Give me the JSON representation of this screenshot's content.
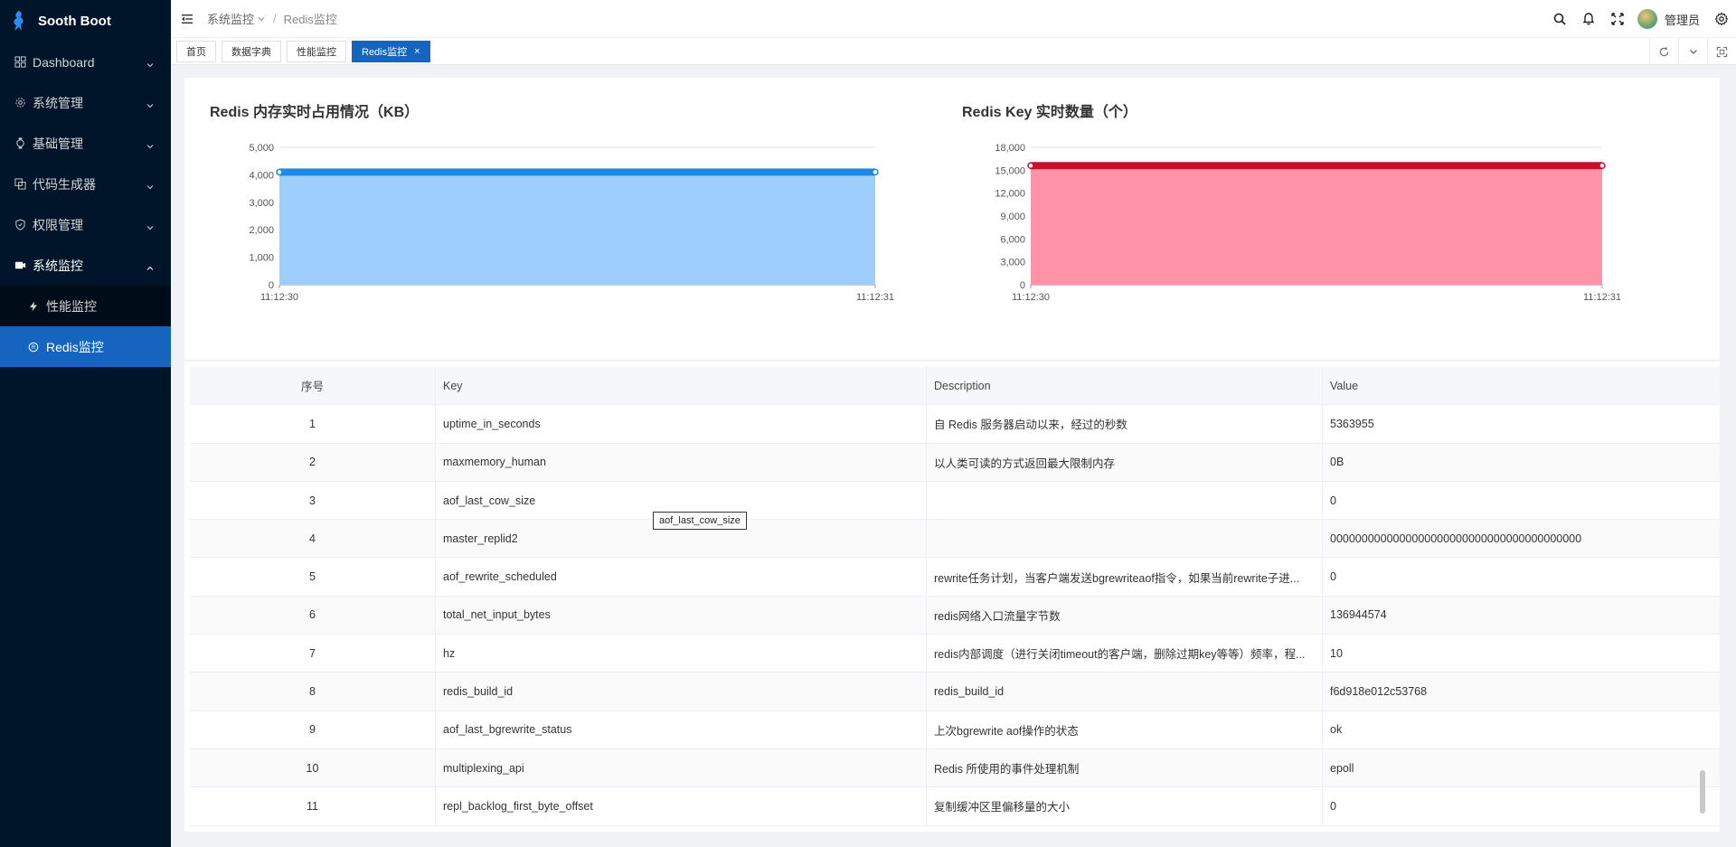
{
  "app": {
    "name": "Sooth Boot"
  },
  "sidebar": {
    "items": [
      {
        "label": "Dashboard",
        "icon": "dashboard-icon",
        "open": false
      },
      {
        "label": "系统管理",
        "icon": "gear-icon",
        "open": false
      },
      {
        "label": "基础管理",
        "icon": "watch-icon",
        "open": false
      },
      {
        "label": "代码生成器",
        "icon": "code-icon",
        "open": false
      },
      {
        "label": "权限管理",
        "icon": "shield-icon",
        "open": false
      },
      {
        "label": "系统监控",
        "icon": "monitor-icon",
        "open": true
      }
    ],
    "sub_items": [
      {
        "label": "性能监控",
        "icon": "lightning-icon",
        "active": false
      },
      {
        "label": "Redis监控",
        "icon": "redis-icon",
        "active": true
      }
    ],
    "accent": "#1565c0",
    "bg": "#001529"
  },
  "header": {
    "breadcrumb": [
      "系统监控",
      "Redis监控"
    ],
    "user": "管理员"
  },
  "tabs": [
    {
      "label": "首页",
      "active": false
    },
    {
      "label": "数据字典",
      "active": false
    },
    {
      "label": "性能监控",
      "active": false
    },
    {
      "label": "Redis监控",
      "active": true,
      "closable": true
    }
  ],
  "chart_data": [
    {
      "type": "area",
      "title": "Redis 内存实时占用情况（KB）",
      "x": [
        "11:12:30",
        "11:12:31"
      ],
      "values": [
        4100,
        4100
      ],
      "ylim": [
        0,
        5000
      ],
      "yticks": [
        0,
        1000,
        2000,
        3000,
        4000,
        5000
      ],
      "yticklabels": [
        "0",
        "1,000",
        "2,000",
        "3,000",
        "4,000",
        "5,000"
      ],
      "line_color": "#1e88e5",
      "fill_color": "#9ecffc"
    },
    {
      "type": "area",
      "title": "Redis Key 实时数量（个）",
      "x": [
        "11:12:30",
        "11:12:31"
      ],
      "values": [
        15600,
        15600
      ],
      "ylim": [
        0,
        18000
      ],
      "yticks": [
        0,
        3000,
        6000,
        9000,
        12000,
        15000,
        18000
      ],
      "yticklabels": [
        "0",
        "3,000",
        "6,000",
        "9,000",
        "12,000",
        "15,000",
        "18,000"
      ],
      "line_color": "#c8102e",
      "fill_color": "#ff94a8"
    }
  ],
  "table": {
    "headers": [
      "序号",
      "Key",
      "Description",
      "Value"
    ],
    "rows": [
      [
        "1",
        "uptime_in_seconds",
        "自 Redis 服务器启动以来，经过的秒数",
        "5363955"
      ],
      [
        "2",
        "maxmemory_human",
        "以人类可读的方式返回最大限制内存",
        "0B"
      ],
      [
        "3",
        "aof_last_cow_size",
        "",
        "0"
      ],
      [
        "4",
        "master_replid2",
        "",
        "0000000000000000000000000000000000000000"
      ],
      [
        "5",
        "aof_rewrite_scheduled",
        "rewrite任务计划，当客户端发送bgrewriteaof指令，如果当前rewrite子进...",
        "0"
      ],
      [
        "6",
        "total_net_input_bytes",
        "redis网络入口流量字节数",
        "136944574"
      ],
      [
        "7",
        "hz",
        "redis内部调度（进行关闭timeout的客户端，删除过期key等等）频率，程...",
        "10"
      ],
      [
        "8",
        "redis_build_id",
        "redis_build_id",
        "f6d918e012c53768"
      ],
      [
        "9",
        "aof_last_bgrewrite_status",
        "上次bgrewrite aof操作的状态",
        "ok"
      ],
      [
        "10",
        "multiplexing_api",
        "Redis 所使用的事件处理机制",
        "epoll"
      ],
      [
        "11",
        "repl_backlog_first_byte_offset",
        "复制缓冲区里偏移量的大小",
        "0"
      ]
    ],
    "tooltip": "aof_last_cow_size"
  }
}
